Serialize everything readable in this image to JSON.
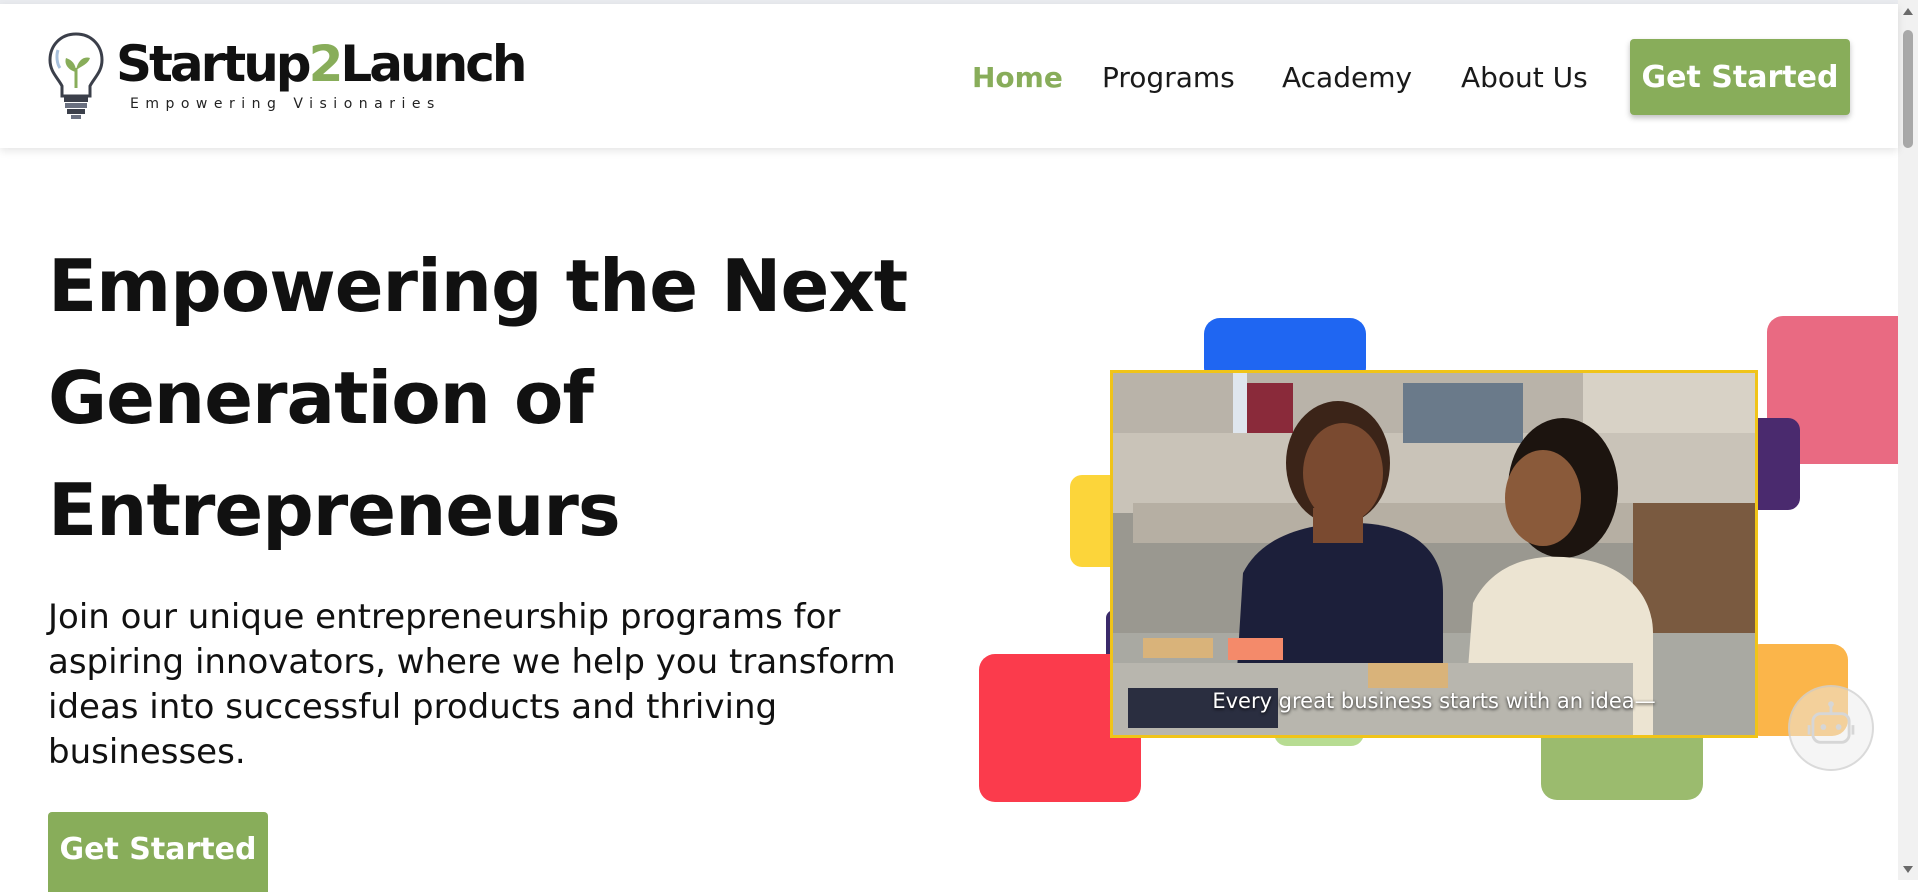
{
  "brand": {
    "name_prefix": "Startup",
    "name_highlight": "2",
    "name_suffix": "Launch",
    "tagline": "Empowering Visionaries"
  },
  "nav": {
    "items": [
      {
        "label": "Home",
        "active": true
      },
      {
        "label": "Programs",
        "active": false
      },
      {
        "label": "Academy",
        "active": false
      },
      {
        "label": "About Us",
        "active": false
      }
    ],
    "cta_label": "Get Started"
  },
  "hero": {
    "title_lines": [
      "Empowering the Next",
      "Generation of",
      "Entrepreneurs"
    ],
    "subtitle": "Join our unique entrepreneurship programs for aspiring innovators, where we help you transform ideas into successful products and thriving businesses.",
    "cta_label": "Get Started"
  },
  "video": {
    "caption": "Every great business starts with an idea—"
  },
  "icons": {
    "logo": "lightbulb-seedling-icon",
    "chat": "chatbot-icon"
  },
  "colors": {
    "accent": "#88ad5a",
    "tile_blue": "#1f66f2",
    "tile_pink": "#e96a82",
    "tile_purple": "#4a2a6e",
    "tile_yellow": "#fcd53a",
    "tile_red": "#fb3b4c",
    "tile_green": "#9bbb6e",
    "tile_orange": "#fbb54a",
    "video_border": "#f0c419"
  }
}
